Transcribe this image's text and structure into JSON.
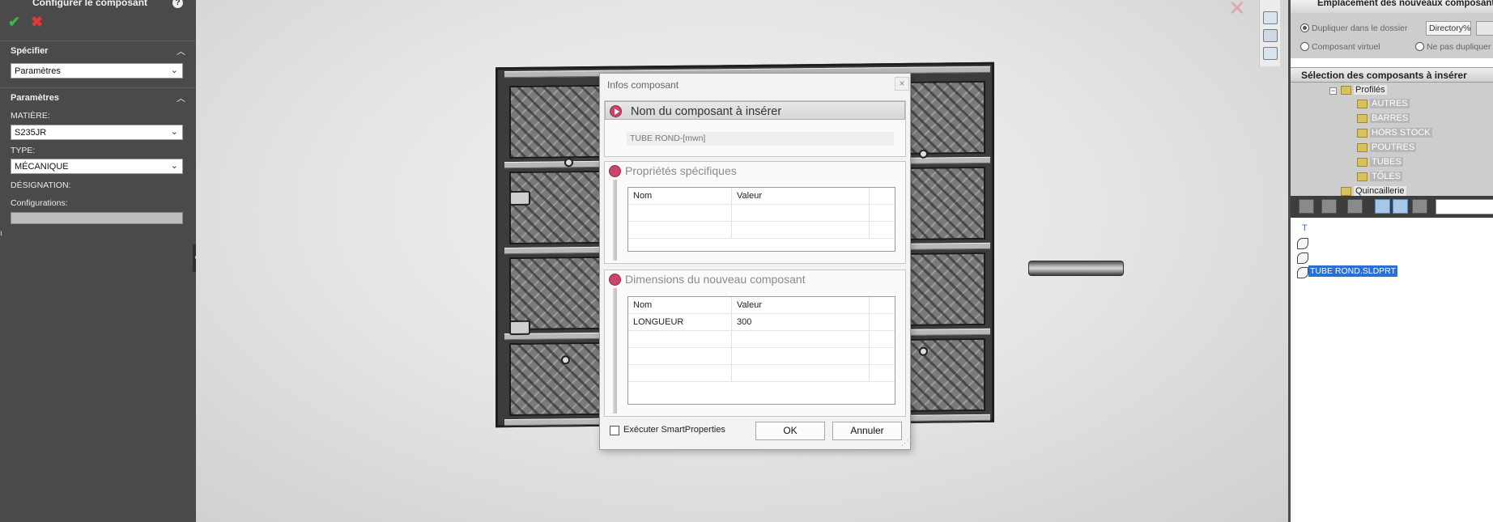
{
  "property_manager": {
    "title": "Configurer le composant",
    "specifier": {
      "header": "Spécifier",
      "value": "Paramètres"
    },
    "parametres": {
      "header": "Paramètres",
      "matiere_label": "MATIÈRE:",
      "matiere_value": "S235JR",
      "type_label": "TYPE:",
      "type_value": "MÉCANIQUE",
      "designation_label": "DÉSIGNATION:",
      "configurations_label": "Configurations:"
    }
  },
  "dialog": {
    "title": "Infos composant",
    "close_label": "×",
    "name_section": {
      "header": "Nom du composant à insérer",
      "value": "TUBE ROND-[mwn]"
    },
    "specific_props": {
      "header": "Propriétés spécifiques",
      "columns": [
        "Nom",
        "Valeur"
      ],
      "rows": []
    },
    "dimensions": {
      "header": "Dimensions du nouveau composant",
      "columns": [
        "Nom",
        "Valeur"
      ],
      "rows": [
        {
          "name": "LONGUEUR",
          "value": "300"
        }
      ]
    },
    "smartproperties_label": "Exécuter SmartProperties",
    "ok_label": "OK",
    "cancel_label": "Annuler"
  },
  "right_panel": {
    "header": "Emplacement des nouveaux composants",
    "options": {
      "dup_folder": "Dupliquer dans le dossier",
      "directory_value": "Directory%",
      "virtual": "Composant virtuel",
      "no_dup": "Ne pas dupliquer"
    },
    "selection_header": "Sélection des composants à insérer",
    "tree": {
      "root": "Profilés",
      "children": [
        "AUTRES",
        "BARRES",
        "HORS STOCK",
        "POUTRES",
        "TUBES",
        "TÔLES"
      ],
      "next_root": "Quincaillerie"
    },
    "files": {
      "type_letter": "T",
      "selected": "TUBE ROND.SLDPRT"
    }
  }
}
